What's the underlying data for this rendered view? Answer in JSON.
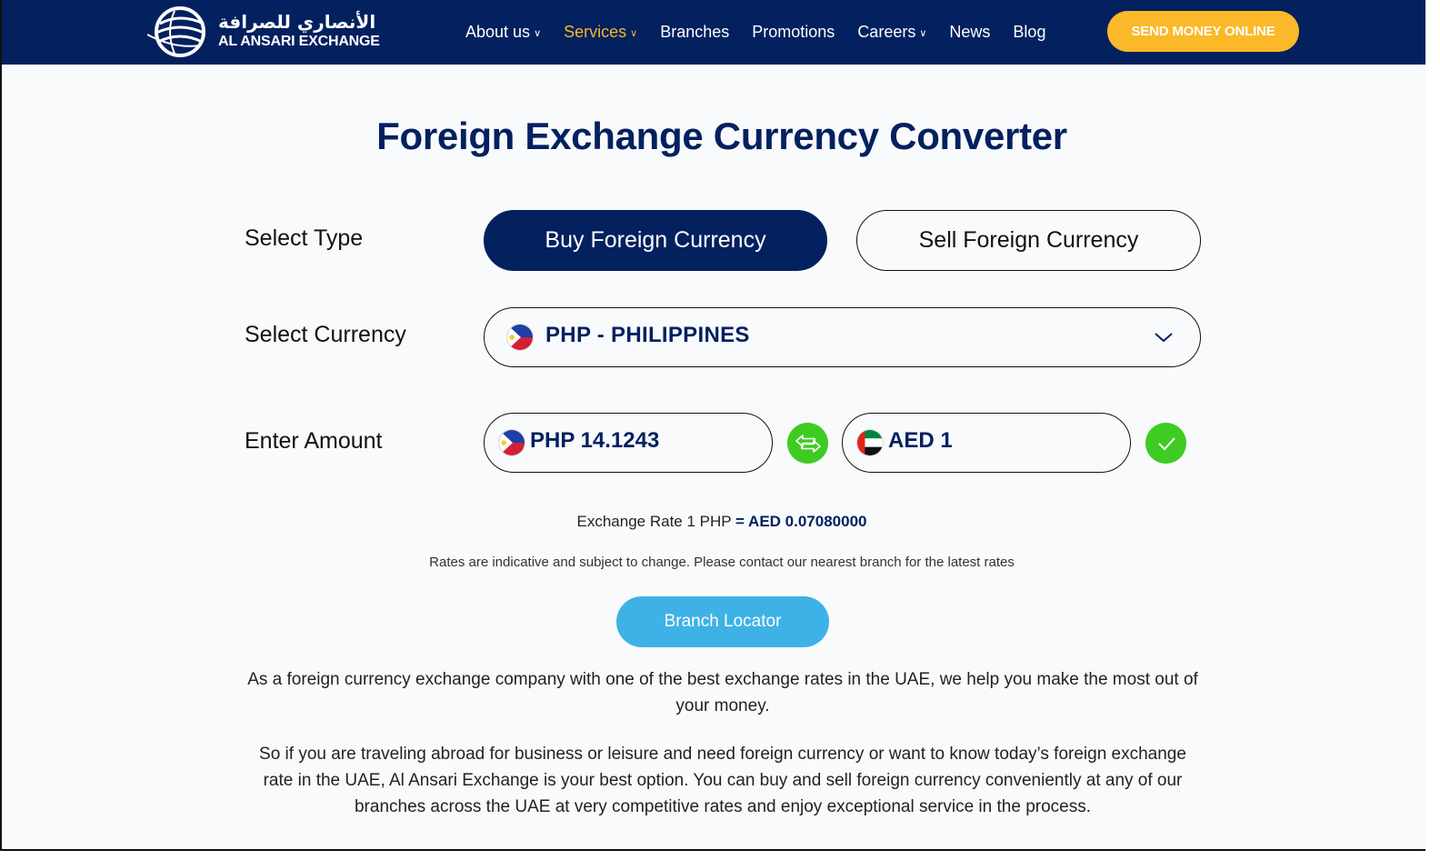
{
  "nav": {
    "logo": {
      "arabic": "الأنصاري للصرافة",
      "english": "AL ANSARI EXCHANGE"
    },
    "items": [
      {
        "label": "About us",
        "has_dropdown": true,
        "active": false
      },
      {
        "label": "Services",
        "has_dropdown": true,
        "active": true
      },
      {
        "label": "Branches",
        "has_dropdown": false,
        "active": false
      },
      {
        "label": "Promotions",
        "has_dropdown": false,
        "active": false
      },
      {
        "label": "Careers",
        "has_dropdown": true,
        "active": false
      },
      {
        "label": "News",
        "has_dropdown": false,
        "active": false
      },
      {
        "label": "Blog",
        "has_dropdown": false,
        "active": false
      }
    ],
    "cta_label": "SEND MONEY ONLINE"
  },
  "converter": {
    "title": "Foreign Exchange Currency Converter",
    "type_label": "Select Type",
    "buy_label": "Buy Foreign Currency",
    "sell_label": "Sell Foreign Currency",
    "selected_type": "buy",
    "currency_label": "Select Currency",
    "selected_currency": "PHP - PHILIPPINES",
    "amount_label": "Enter Amount",
    "from_amount": "PHP 14.1243",
    "to_amount": "AED 1",
    "rate_prefix": "Exchange Rate 1 PHP ",
    "rate_value": "= AED 0.07080000",
    "disclaimer": "Rates are indicative and subject to change. Please contact our nearest branch for the latest rates",
    "locator_label": "Branch Locator"
  },
  "content": {
    "paragraph1": "As a foreign currency exchange company with one of the best exchange rates in the UAE, we help you make the most out of your money.",
    "paragraph2": "So if you are traveling abroad for business or leisure and need foreign currency or want to know today’s foreign exchange rate in the UAE, Al Ansari Exchange is your best option. You can buy and sell foreign currency conveniently at any of our branches across the UAE at very competitive rates and enjoy exceptional service in the process."
  },
  "colors": {
    "brand_navy": "#03205f",
    "accent_yellow": "#fbb829",
    "active_nav": "#f5b82a",
    "action_green": "#3fcc22",
    "locator_blue": "#3eb2e6"
  }
}
